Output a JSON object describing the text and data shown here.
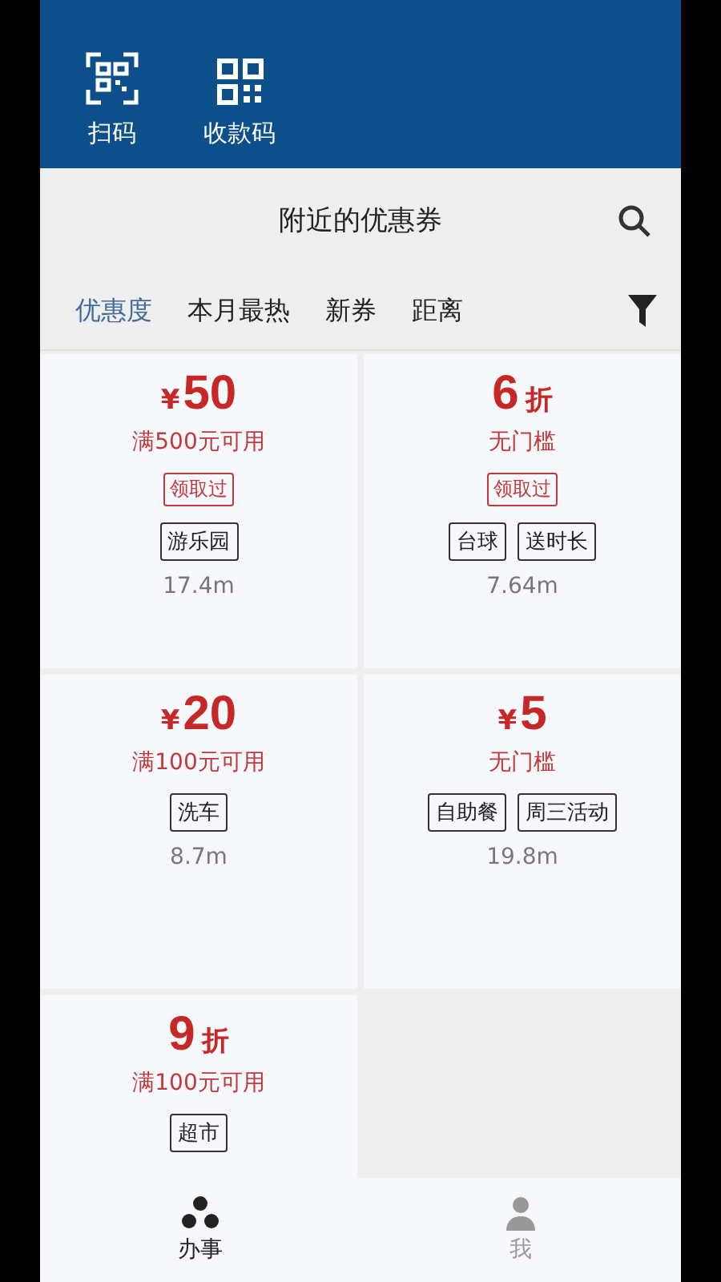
{
  "header": {
    "actions": [
      {
        "kind": "scan",
        "label": "扫码"
      },
      {
        "kind": "qrcode",
        "label": "收款码"
      }
    ]
  },
  "title_bar": {
    "title": "附近的优惠券"
  },
  "tabs": [
    {
      "label": "优惠度",
      "selected": true
    },
    {
      "label": "本月最热",
      "selected": false
    },
    {
      "label": "新券",
      "selected": false
    },
    {
      "label": "距离",
      "selected": false
    }
  ],
  "coupons": [
    {
      "symbol": "¥",
      "amount": "50",
      "condition": "满500元可用",
      "badge": "领取过",
      "tags": [
        "游乐园"
      ],
      "distance": "17.4m"
    },
    {
      "amount": "6",
      "unit": "折",
      "condition": "无门槛",
      "badge": "领取过",
      "tags": [
        "台球",
        "送时长"
      ],
      "distance": "7.64m"
    },
    {
      "symbol": "¥",
      "amount": "20",
      "condition": "满100元可用",
      "tags": [
        "洗车"
      ],
      "distance": "8.7m"
    },
    {
      "symbol": "¥",
      "amount": "5",
      "condition": "无门槛",
      "tags": [
        "自助餐",
        "周三活动"
      ],
      "distance": "19.8m"
    },
    {
      "amount": "9",
      "unit": "折",
      "condition": "满100元可用",
      "tags": [
        "超市"
      ]
    }
  ],
  "bottom_nav": [
    {
      "kind": "dots",
      "label": "办事",
      "selected": true
    },
    {
      "kind": "person",
      "label": "我",
      "selected": false
    }
  ]
}
